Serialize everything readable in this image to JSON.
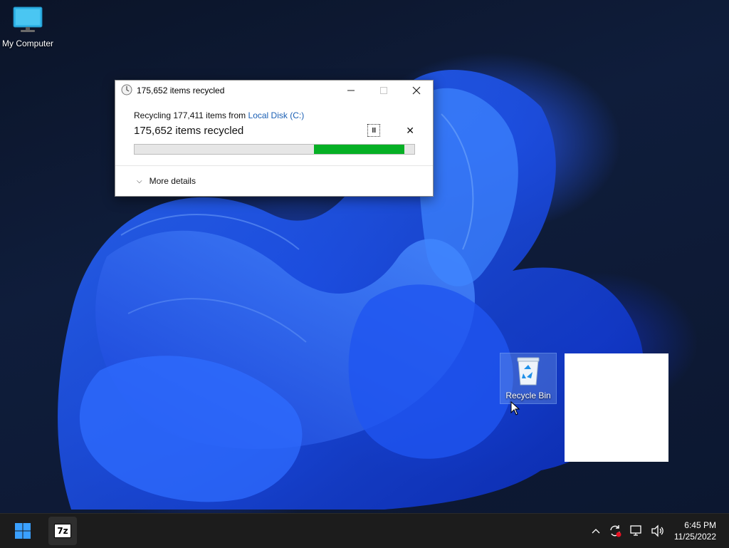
{
  "desktop": {
    "icons": [
      {
        "label": "My Computer",
        "icon": "monitor-icon"
      },
      {
        "label": "Recycle Bin",
        "icon": "recycle-bin-icon"
      }
    ]
  },
  "dialog": {
    "title": "175,652 items recycled",
    "title_icon": "clock-icon",
    "minimize_icon": "minimize-icon",
    "maximize_icon": "maximize-icon",
    "close_icon": "close-icon",
    "status_prefix": "Recycling 177,411 items from",
    "source_link": "Local Disk (C:)",
    "progress_text": "175,652 items recycled",
    "pause_symbol": "II",
    "stop_symbol": "✕",
    "progress": {
      "fraction_start": 0.64,
      "fraction_end": 0.965,
      "color": "#06b025"
    },
    "more_details": "More details",
    "chevron_symbol": "⌵"
  },
  "taskbar": {
    "start_icon": "windows-start-icon",
    "pinned_app": "7zip-icon",
    "pinned_app_label": "7z",
    "tray": {
      "chevron": "^",
      "icons": [
        "sync-icon",
        "network-icon",
        "volume-icon"
      ]
    },
    "clock": {
      "time": "6:45 PM",
      "date": "11/25/2022"
    }
  },
  "colors": {
    "accent": "#1a5fb4",
    "progress": "#06b025",
    "taskbar": "#1c1c1c",
    "start_blue": "#3aa0ff"
  }
}
